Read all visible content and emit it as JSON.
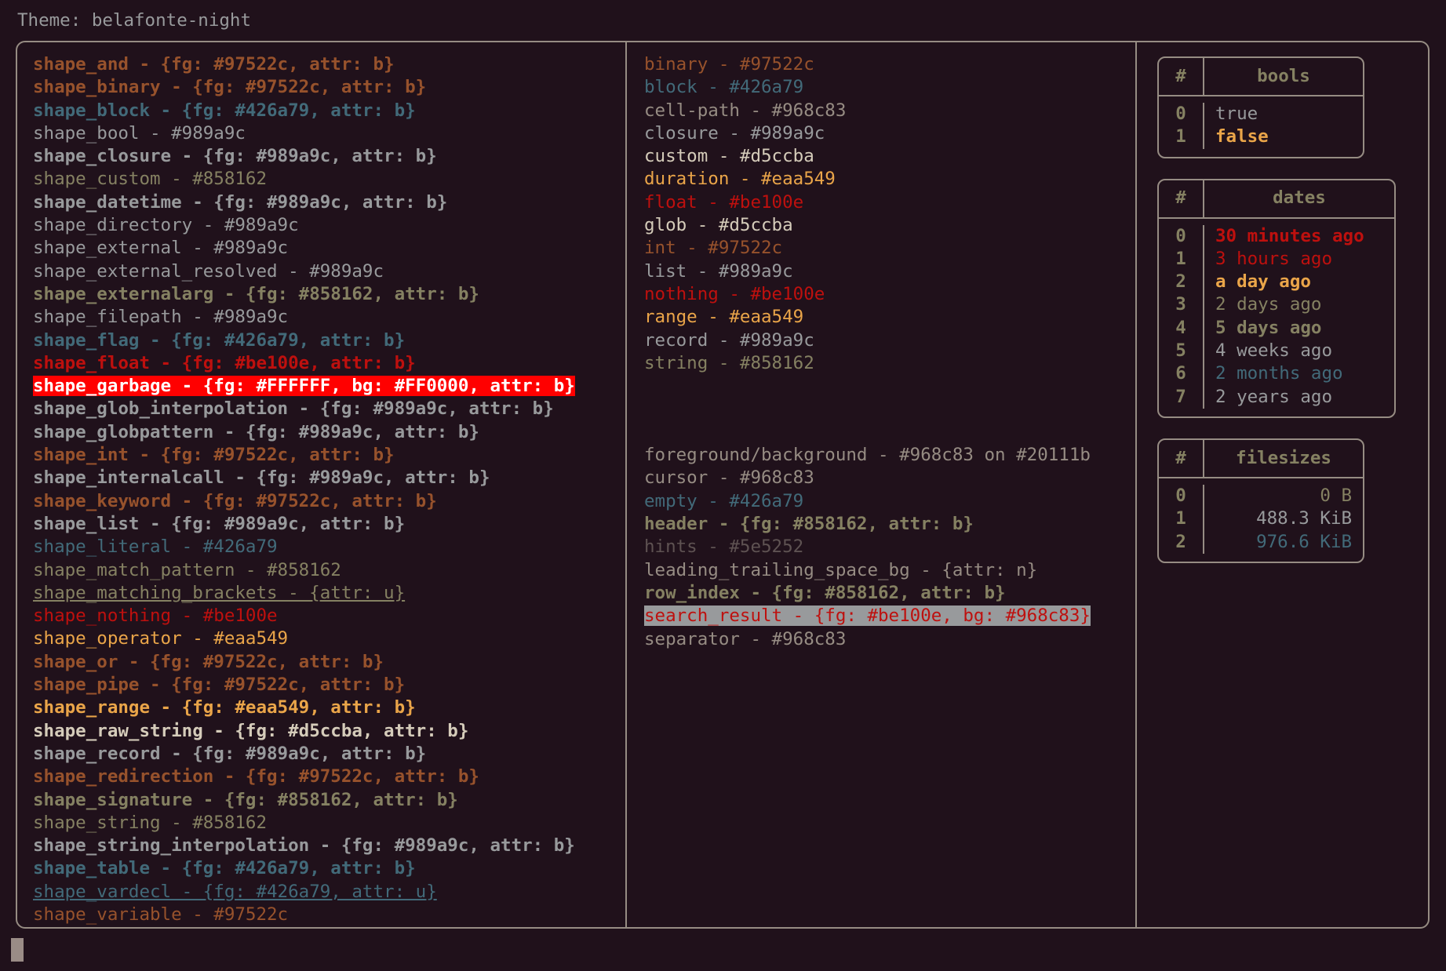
{
  "header": {
    "label": "Theme: belafonte-night"
  },
  "palette": {
    "background": "#20111b",
    "border": "#968c83",
    "orange": "#97522c",
    "blue": "#426a79",
    "grey": "#989a9c",
    "olive": "#858162",
    "red": "#be100e",
    "yellow": "#eaa549",
    "cream": "#d5ccba",
    "hint": "#5e5252",
    "garbage_bg": "#FF0000",
    "garbage_fg": "#FFFFFF"
  },
  "shapes_column": {
    "rows": [
      {
        "text": "shape_and - {fg: #97522c, attr: b}",
        "color": "orange",
        "bold": true
      },
      {
        "text": "shape_binary - {fg: #97522c, attr: b}",
        "color": "orange",
        "bold": true
      },
      {
        "text": "shape_block - {fg: #426a79, attr: b}",
        "color": "blue",
        "bold": true
      },
      {
        "text": "shape_bool - #989a9c",
        "color": "grey",
        "bold": false
      },
      {
        "text": "shape_closure - {fg: #989a9c, attr: b}",
        "color": "grey",
        "bold": true
      },
      {
        "text": "shape_custom - #858162",
        "color": "olive",
        "bold": false
      },
      {
        "text": "shape_datetime - {fg: #989a9c, attr: b}",
        "color": "grey",
        "bold": true
      },
      {
        "text": "shape_directory - #989a9c",
        "color": "grey",
        "bold": false
      },
      {
        "text": "shape_external - #989a9c",
        "color": "grey",
        "bold": false
      },
      {
        "text": "shape_external_resolved - #989a9c",
        "color": "grey",
        "bold": false
      },
      {
        "text": "shape_externalarg - {fg: #858162, attr: b}",
        "color": "olive",
        "bold": true
      },
      {
        "text": "shape_filepath - #989a9c",
        "color": "grey",
        "bold": false
      },
      {
        "text": "shape_flag - {fg: #426a79, attr: b}",
        "color": "blue",
        "bold": true
      },
      {
        "text": "shape_float - {fg: #be100e, attr: b}",
        "color": "red",
        "bold": true
      },
      {
        "text": "shape_garbage - {fg: #FFFFFF, bg: #FF0000, attr: b}",
        "color": "white",
        "bold": true,
        "highlight": "red"
      },
      {
        "text": "shape_glob_interpolation - {fg: #989a9c, attr: b}",
        "color": "grey",
        "bold": true
      },
      {
        "text": "shape_globpattern - {fg: #989a9c, attr: b}",
        "color": "grey",
        "bold": true
      },
      {
        "text": "shape_int - {fg: #97522c, attr: b}",
        "color": "orange",
        "bold": true
      },
      {
        "text": "shape_internalcall - {fg: #989a9c, attr: b}",
        "color": "grey",
        "bold": true
      },
      {
        "text": "shape_keyword - {fg: #97522c, attr: b}",
        "color": "orange",
        "bold": true
      },
      {
        "text": "shape_list - {fg: #989a9c, attr: b}",
        "color": "grey",
        "bold": true
      },
      {
        "text": "shape_literal - #426a79",
        "color": "blue",
        "bold": false
      },
      {
        "text": "shape_match_pattern - #858162",
        "color": "olive",
        "bold": false
      },
      {
        "text": "shape_matching_brackets - {attr: u}",
        "color": "olive",
        "bold": false,
        "underline": true
      },
      {
        "text": "shape_nothing - #be100e",
        "color": "red",
        "bold": false
      },
      {
        "text": "shape_operator - #eaa549",
        "color": "yellow",
        "bold": false
      },
      {
        "text": "shape_or - {fg: #97522c, attr: b}",
        "color": "orange",
        "bold": true
      },
      {
        "text": "shape_pipe - {fg: #97522c, attr: b}",
        "color": "orange",
        "bold": true
      },
      {
        "text": "shape_range - {fg: #eaa549, attr: b}",
        "color": "yellow",
        "bold": true
      },
      {
        "text": "shape_raw_string - {fg: #d5ccba, attr: b}",
        "color": "cream",
        "bold": true
      },
      {
        "text": "shape_record - {fg: #989a9c, attr: b}",
        "color": "grey",
        "bold": true
      },
      {
        "text": "shape_redirection - {fg: #97522c, attr: b}",
        "color": "orange",
        "bold": true
      },
      {
        "text": "shape_signature - {fg: #858162, attr: b}",
        "color": "olive",
        "bold": true
      },
      {
        "text": "shape_string - #858162",
        "color": "olive",
        "bold": false
      },
      {
        "text": "shape_string_interpolation - {fg: #989a9c, attr: b}",
        "color": "grey",
        "bold": true
      },
      {
        "text": "shape_table - {fg: #426a79, attr: b}",
        "color": "blue",
        "bold": true
      },
      {
        "text": "shape_vardecl - {fg: #426a79, attr: u}",
        "color": "blue",
        "bold": false,
        "underline": true
      },
      {
        "text": "shape_variable - #97522c",
        "color": "orange",
        "bold": false
      }
    ]
  },
  "types_column": {
    "rows": [
      {
        "text": "binary - #97522c",
        "color": "orange",
        "bold": false
      },
      {
        "text": "block - #426a79",
        "color": "blue",
        "bold": false
      },
      {
        "text": "cell-path - #968c83",
        "color": "base",
        "bold": false
      },
      {
        "text": "closure - #989a9c",
        "color": "grey",
        "bold": false
      },
      {
        "text": "custom - #d5ccba",
        "color": "cream",
        "bold": false
      },
      {
        "text": "duration - #eaa549",
        "color": "yellow",
        "bold": false
      },
      {
        "text": "float - #be100e",
        "color": "red",
        "bold": false
      },
      {
        "text": "glob - #d5ccba",
        "color": "cream",
        "bold": false
      },
      {
        "text": "int - #97522c",
        "color": "orange",
        "bold": false
      },
      {
        "text": "list - #989a9c",
        "color": "grey",
        "bold": false
      },
      {
        "text": "nothing - #be100e",
        "color": "red",
        "bold": false
      },
      {
        "text": "range - #eaa549",
        "color": "yellow",
        "bold": false
      },
      {
        "text": "record - #989a9c",
        "color": "grey",
        "bold": false
      },
      {
        "text": "string - #858162",
        "color": "olive",
        "bold": false
      }
    ],
    "ui_rows": [
      {
        "text": "foreground/background - #968c83 on #20111b",
        "color": "base",
        "bold": false
      },
      {
        "text": "cursor - #968c83",
        "color": "base",
        "bold": false
      },
      {
        "text": "empty - #426a79",
        "color": "blue",
        "bold": false
      },
      {
        "text": "header - {fg: #858162, attr: b}",
        "color": "olive",
        "bold": true
      },
      {
        "text": "hints - #5e5252",
        "color": "hint",
        "bold": false
      },
      {
        "text": "leading_trailing_space_bg - {attr: n}",
        "color": "base",
        "bold": false
      },
      {
        "text": "row_index - {fg: #858162, attr: b}",
        "color": "olive",
        "bold": true
      },
      {
        "text": "search_result - {fg: #be100e, bg: #968c83}",
        "color": "red",
        "bold": false,
        "highlight": "grey"
      },
      {
        "text": "separator - #968c83",
        "color": "base",
        "bold": false
      }
    ]
  },
  "side_tables": [
    {
      "name": "bools",
      "index_header": "#",
      "value_header": "bools",
      "align": "left",
      "rows": [
        {
          "index": "0",
          "value": "true",
          "color": "grey",
          "bold": false
        },
        {
          "index": "1",
          "value": "false",
          "color": "yellow",
          "bold": true
        }
      ]
    },
    {
      "name": "dates",
      "index_header": "#",
      "value_header": "dates",
      "align": "left",
      "rows": [
        {
          "index": "0",
          "value": "30 minutes ago",
          "color": "red",
          "bold": true
        },
        {
          "index": "1",
          "value": "3 hours ago",
          "color": "red",
          "bold": false
        },
        {
          "index": "2",
          "value": "a day ago",
          "color": "yellow",
          "bold": true
        },
        {
          "index": "3",
          "value": "2 days ago",
          "color": "olive",
          "bold": false
        },
        {
          "index": "4",
          "value": "5 days ago",
          "color": "olive",
          "bold": true
        },
        {
          "index": "5",
          "value": "4 weeks ago",
          "color": "grey",
          "bold": false
        },
        {
          "index": "6",
          "value": "2 months ago",
          "color": "blue",
          "bold": false
        },
        {
          "index": "7",
          "value": "2 years ago",
          "color": "grey",
          "bold": false
        }
      ]
    },
    {
      "name": "filesizes",
      "index_header": "#",
      "value_header": "filesizes",
      "align": "right",
      "rows": [
        {
          "index": "0",
          "value": "0 B",
          "color": "olive",
          "bold": false
        },
        {
          "index": "1",
          "value": "488.3 KiB",
          "color": "grey",
          "bold": false
        },
        {
          "index": "2",
          "value": "976.6 KiB",
          "color": "blue",
          "bold": false
        }
      ]
    }
  ]
}
